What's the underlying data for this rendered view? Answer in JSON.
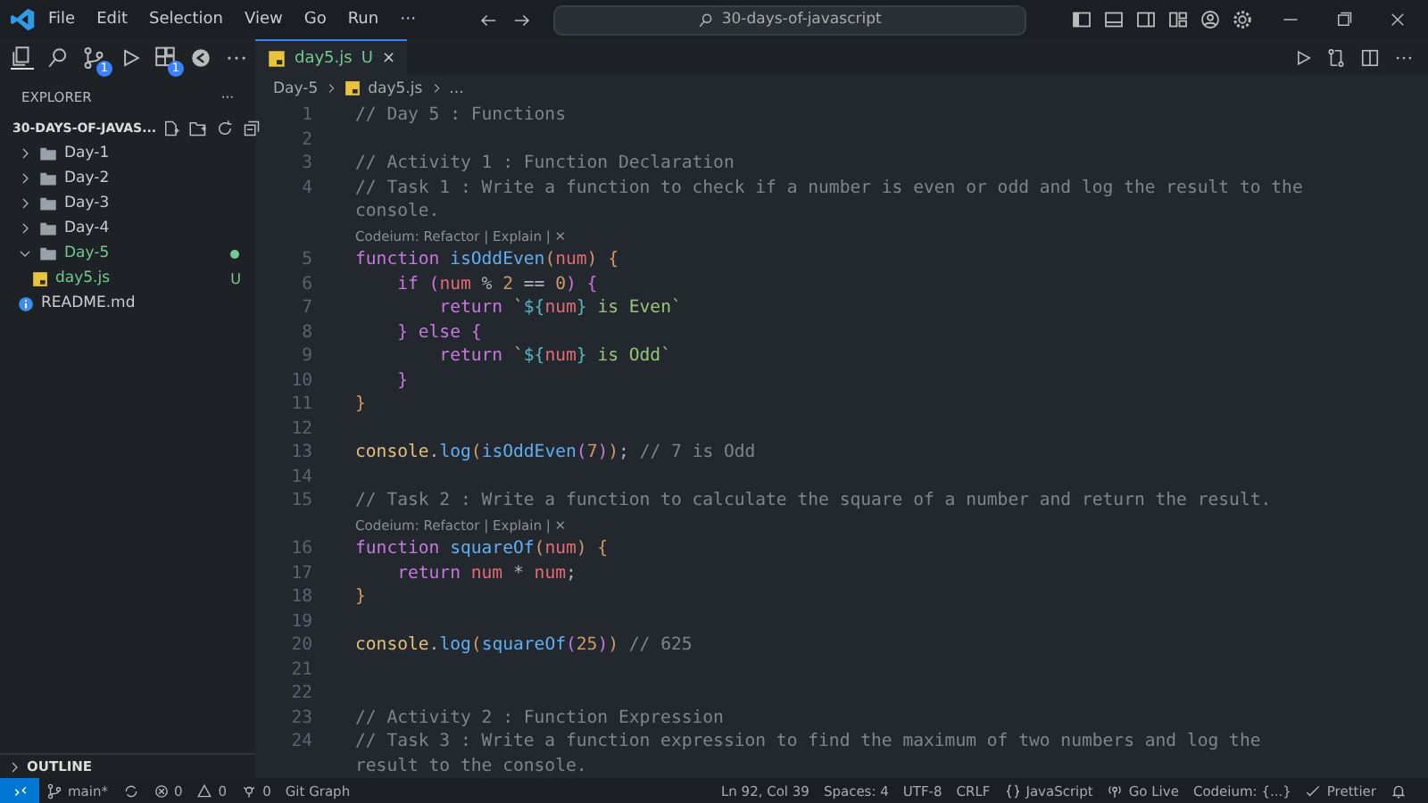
{
  "menu": [
    "File",
    "Edit",
    "Selection",
    "View",
    "Go",
    "Run",
    "⋯"
  ],
  "command_center": {
    "text": "30-days-of-javascript"
  },
  "activity": [
    {
      "kind": "files",
      "selected": true
    },
    {
      "kind": "search",
      "selected": false
    },
    {
      "kind": "branch",
      "badge": "1",
      "selected": false
    },
    {
      "kind": "run",
      "selected": false
    },
    {
      "kind": "extensions",
      "badge": "1",
      "selected": false
    },
    {
      "kind": "codeium",
      "selected": false
    },
    {
      "kind": "more",
      "selected": false
    }
  ],
  "tabs": [
    {
      "label": "day5.js",
      "status": "U",
      "close": "×",
      "selected": true
    }
  ],
  "breadcrumb": {
    "folder": "Day-5",
    "file": "day5.js",
    "rest": "..."
  },
  "sidebar": {
    "title": "EXPLORER",
    "more": "···",
    "root": "30-DAYS-OF-JAVAS...",
    "tree": [
      {
        "kind": "folder",
        "label": "Day-1",
        "expanded": false,
        "modified": false
      },
      {
        "kind": "folder",
        "label": "Day-2",
        "expanded": false,
        "modified": false
      },
      {
        "kind": "folder",
        "label": "Day-3",
        "expanded": false,
        "modified": false
      },
      {
        "kind": "folder",
        "label": "Day-4",
        "expanded": false,
        "modified": false
      },
      {
        "kind": "folder",
        "label": "Day-5",
        "expanded": true,
        "modified": true,
        "children": [
          {
            "kind": "js",
            "label": "day5.js",
            "status": "U",
            "modified": true
          }
        ]
      },
      {
        "kind": "info",
        "label": "README.md",
        "modified": false
      }
    ],
    "outline": "OUTLINE"
  },
  "code": [
    {
      "kind": "line",
      "number": "1",
      "tokens": [
        {
          "kind": "comment",
          "text": "// Day 5 : Functions"
        }
      ]
    },
    {
      "kind": "line",
      "number": "2"
    },
    {
      "kind": "line",
      "number": "3",
      "tokens": [
        {
          "kind": "comment",
          "text": "// Activity 1 : Function Declaration"
        }
      ]
    },
    {
      "kind": "line",
      "number": "4",
      "tokens": [
        {
          "kind": "comment",
          "text": "// Task 1 : Write a function to check if a number is even or odd and log the result to the"
        }
      ]
    },
    {
      "kind": "wrap",
      "tokens": [
        {
          "kind": "comment",
          "text": "console."
        }
      ]
    },
    {
      "kind": "lens",
      "text": "Codeium: Refactor | Explain | ✕"
    },
    {
      "kind": "line",
      "number": "5",
      "tokens": [
        {
          "kind": "keyword",
          "text": "function "
        },
        {
          "kind": "function",
          "text": "isOddEven"
        },
        {
          "kind": "paren",
          "text": "("
        },
        {
          "kind": "variable",
          "text": "num"
        },
        {
          "kind": "paren",
          "text": ") {"
        }
      ]
    },
    {
      "kind": "line",
      "number": "6",
      "tokens": [
        {
          "kind": "keyword",
          "text": "    if "
        },
        {
          "kind": "bracket",
          "text": "("
        },
        {
          "kind": "variable",
          "text": "num"
        },
        {
          "kind": "plain",
          "text": " % "
        },
        {
          "kind": "number",
          "text": "2"
        },
        {
          "kind": "plain",
          "text": " == "
        },
        {
          "kind": "number",
          "text": "0"
        },
        {
          "kind": "bracket",
          "text": ") {"
        }
      ]
    },
    {
      "kind": "line",
      "number": "7",
      "tokens": [
        {
          "kind": "keyword",
          "text": "        return "
        },
        {
          "kind": "string",
          "text": "`"
        },
        {
          "kind": "template",
          "text": "${"
        },
        {
          "kind": "variable",
          "text": "num"
        },
        {
          "kind": "template",
          "text": "}"
        },
        {
          "kind": "string",
          "text": " is Even`"
        }
      ]
    },
    {
      "kind": "line",
      "number": "8",
      "tokens": [
        {
          "kind": "bracket",
          "text": "    } "
        },
        {
          "kind": "keyword",
          "text": "else "
        },
        {
          "kind": "bracket",
          "text": "{"
        }
      ]
    },
    {
      "kind": "line",
      "number": "9",
      "tokens": [
        {
          "kind": "keyword",
          "text": "        return "
        },
        {
          "kind": "string",
          "text": "`"
        },
        {
          "kind": "template",
          "text": "${"
        },
        {
          "kind": "variable",
          "text": "num"
        },
        {
          "kind": "template",
          "text": "}"
        },
        {
          "kind": "string",
          "text": " is Odd`"
        }
      ]
    },
    {
      "kind": "line",
      "number": "10",
      "tokens": [
        {
          "kind": "bracket",
          "text": "    }"
        }
      ]
    },
    {
      "kind": "line",
      "number": "11",
      "tokens": [
        {
          "kind": "paren",
          "text": "}"
        }
      ]
    },
    {
      "kind": "line",
      "number": "12"
    },
    {
      "kind": "line",
      "number": "13",
      "tokens": [
        {
          "kind": "object",
          "text": "console"
        },
        {
          "kind": "plain",
          "text": "."
        },
        {
          "kind": "function",
          "text": "log"
        },
        {
          "kind": "paren",
          "text": "("
        },
        {
          "kind": "function",
          "text": "isOddEven"
        },
        {
          "kind": "bracket",
          "text": "("
        },
        {
          "kind": "number",
          "text": "7"
        },
        {
          "kind": "bracket",
          "text": ")"
        },
        {
          "kind": "paren",
          "text": ")"
        },
        {
          "kind": "plain",
          "text": "; "
        },
        {
          "kind": "comment",
          "text": "// 7 is Odd"
        }
      ]
    },
    {
      "kind": "line",
      "number": "14"
    },
    {
      "kind": "line",
      "number": "15",
      "tokens": [
        {
          "kind": "comment",
          "text": "// Task 2 : Write a function to calculate the square of a number and return the result."
        }
      ]
    },
    {
      "kind": "lens",
      "text": "Codeium: Refactor | Explain | ✕"
    },
    {
      "kind": "line",
      "number": "16",
      "tokens": [
        {
          "kind": "keyword",
          "text": "function "
        },
        {
          "kind": "function",
          "text": "squareOf"
        },
        {
          "kind": "paren",
          "text": "("
        },
        {
          "kind": "variable",
          "text": "num"
        },
        {
          "kind": "paren",
          "text": ") {"
        }
      ]
    },
    {
      "kind": "line",
      "number": "17",
      "tokens": [
        {
          "kind": "keyword",
          "text": "    return "
        },
        {
          "kind": "variable",
          "text": "num"
        },
        {
          "kind": "plain",
          "text": " * "
        },
        {
          "kind": "variable",
          "text": "num"
        },
        {
          "kind": "plain",
          "text": ";"
        }
      ]
    },
    {
      "kind": "line",
      "number": "18",
      "tokens": [
        {
          "kind": "paren",
          "text": "}"
        }
      ]
    },
    {
      "kind": "line",
      "number": "19"
    },
    {
      "kind": "line",
      "number": "20",
      "tokens": [
        {
          "kind": "object",
          "text": "console"
        },
        {
          "kind": "plain",
          "text": "."
        },
        {
          "kind": "function",
          "text": "log"
        },
        {
          "kind": "paren",
          "text": "("
        },
        {
          "kind": "function",
          "text": "squareOf"
        },
        {
          "kind": "bracket",
          "text": "("
        },
        {
          "kind": "number",
          "text": "25"
        },
        {
          "kind": "bracket",
          "text": ")"
        },
        {
          "kind": "paren",
          "text": ")"
        },
        {
          "kind": "comment",
          "text": " // 625"
        }
      ]
    },
    {
      "kind": "line",
      "number": "21"
    },
    {
      "kind": "line",
      "number": "22"
    },
    {
      "kind": "line",
      "number": "23",
      "tokens": [
        {
          "kind": "comment",
          "text": "// Activity 2 : Function Expression"
        }
      ]
    },
    {
      "kind": "line",
      "number": "24",
      "tokens": [
        {
          "kind": "comment",
          "text": "// Task 3 : Write a function expression to find the maximum of two numbers and log the"
        }
      ]
    },
    {
      "kind": "wrap",
      "tokens": [
        {
          "kind": "comment",
          "text": "result to the console."
        }
      ]
    }
  ],
  "status_bar": {
    "left": [
      {
        "kind": "remote"
      },
      {
        "kind": "branch",
        "text": "main*"
      },
      {
        "kind": "sync"
      },
      {
        "kind": "error",
        "text": "0"
      },
      {
        "kind": "warning",
        "text": "0"
      },
      {
        "kind": "ports",
        "text": "0"
      },
      {
        "kind": "text",
        "text": "Git Graph"
      }
    ],
    "right": [
      {
        "kind": "text",
        "text": "Ln 92, Col 39"
      },
      {
        "kind": "text",
        "text": "Spaces: 4"
      },
      {
        "kind": "text",
        "text": "UTF-8"
      },
      {
        "kind": "text",
        "text": "CRLF"
      },
      {
        "kind": "braces",
        "text": "JavaScript"
      },
      {
        "kind": "broadcast",
        "text": "Go Live"
      },
      {
        "kind": "text",
        "text": "Codeium: {...}"
      },
      {
        "kind": "check",
        "text": "Prettier"
      },
      {
        "kind": "bell"
      }
    ]
  }
}
